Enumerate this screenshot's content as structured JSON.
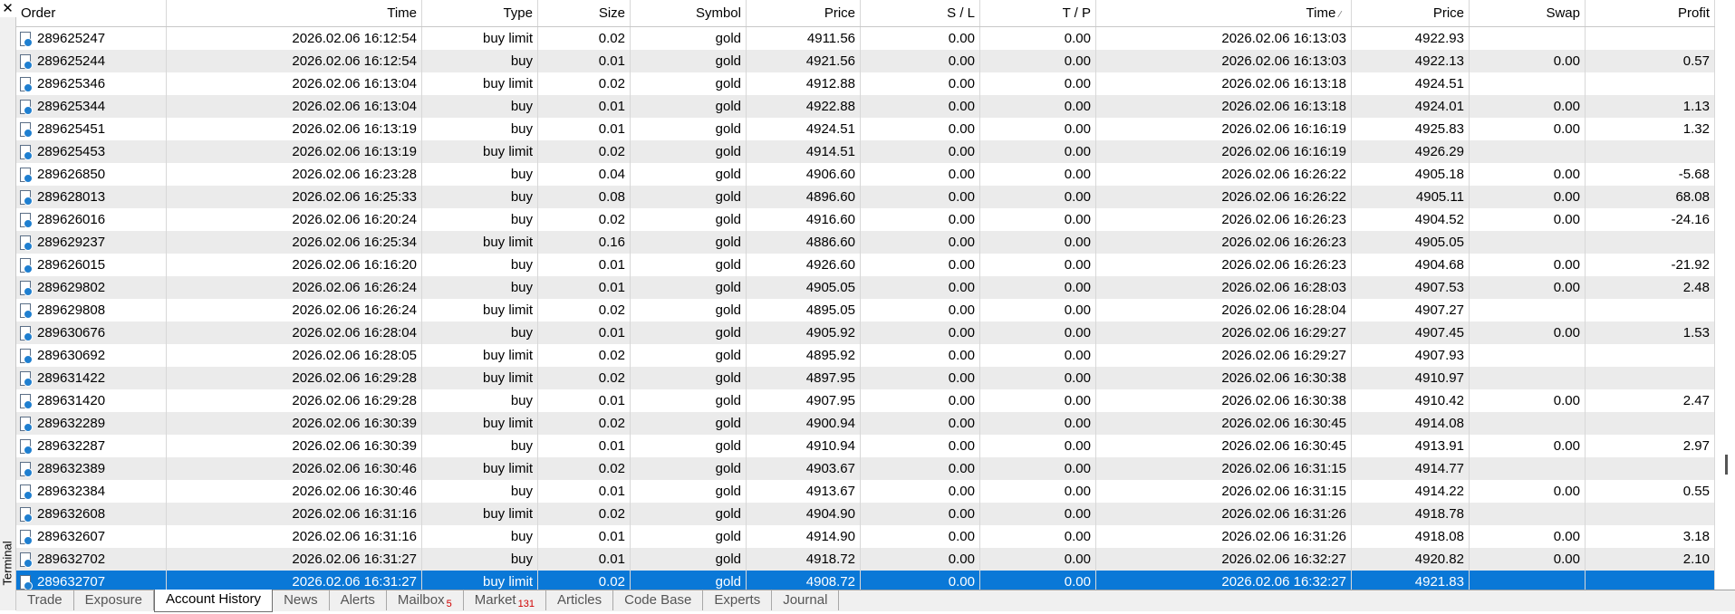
{
  "window": {
    "close_glyph": "✕",
    "side_label": "Terminal"
  },
  "columns": [
    "Order",
    "Time",
    "Type",
    "Size",
    "Symbol",
    "Price",
    "S / L",
    "T / P",
    "Time",
    "Price",
    "Swap",
    "Profit"
  ],
  "sort_indicator": "⁄",
  "rows": [
    [
      "289625247",
      "2026.02.06 16:12:54",
      "buy limit",
      "0.02",
      "gold",
      "4911.56",
      "0.00",
      "0.00",
      "2026.02.06 16:13:03",
      "4922.93",
      "",
      ""
    ],
    [
      "289625244",
      "2026.02.06 16:12:54",
      "buy",
      "0.01",
      "gold",
      "4921.56",
      "0.00",
      "0.00",
      "2026.02.06 16:13:03",
      "4922.13",
      "0.00",
      "0.57"
    ],
    [
      "289625346",
      "2026.02.06 16:13:04",
      "buy limit",
      "0.02",
      "gold",
      "4912.88",
      "0.00",
      "0.00",
      "2026.02.06 16:13:18",
      "4924.51",
      "",
      ""
    ],
    [
      "289625344",
      "2026.02.06 16:13:04",
      "buy",
      "0.01",
      "gold",
      "4922.88",
      "0.00",
      "0.00",
      "2026.02.06 16:13:18",
      "4924.01",
      "0.00",
      "1.13"
    ],
    [
      "289625451",
      "2026.02.06 16:13:19",
      "buy",
      "0.01",
      "gold",
      "4924.51",
      "0.00",
      "0.00",
      "2026.02.06 16:16:19",
      "4925.83",
      "0.00",
      "1.32"
    ],
    [
      "289625453",
      "2026.02.06 16:13:19",
      "buy limit",
      "0.02",
      "gold",
      "4914.51",
      "0.00",
      "0.00",
      "2026.02.06 16:16:19",
      "4926.29",
      "",
      ""
    ],
    [
      "289626850",
      "2026.02.06 16:23:28",
      "buy",
      "0.04",
      "gold",
      "4906.60",
      "0.00",
      "0.00",
      "2026.02.06 16:26:22",
      "4905.18",
      "0.00",
      "-5.68"
    ],
    [
      "289628013",
      "2026.02.06 16:25:33",
      "buy",
      "0.08",
      "gold",
      "4896.60",
      "0.00",
      "0.00",
      "2026.02.06 16:26:22",
      "4905.11",
      "0.00",
      "68.08"
    ],
    [
      "289626016",
      "2026.02.06 16:20:24",
      "buy",
      "0.02",
      "gold",
      "4916.60",
      "0.00",
      "0.00",
      "2026.02.06 16:26:23",
      "4904.52",
      "0.00",
      "-24.16"
    ],
    [
      "289629237",
      "2026.02.06 16:25:34",
      "buy limit",
      "0.16",
      "gold",
      "4886.60",
      "0.00",
      "0.00",
      "2026.02.06 16:26:23",
      "4905.05",
      "",
      ""
    ],
    [
      "289626015",
      "2026.02.06 16:16:20",
      "buy",
      "0.01",
      "gold",
      "4926.60",
      "0.00",
      "0.00",
      "2026.02.06 16:26:23",
      "4904.68",
      "0.00",
      "-21.92"
    ],
    [
      "289629802",
      "2026.02.06 16:26:24",
      "buy",
      "0.01",
      "gold",
      "4905.05",
      "0.00",
      "0.00",
      "2026.02.06 16:28:03",
      "4907.53",
      "0.00",
      "2.48"
    ],
    [
      "289629808",
      "2026.02.06 16:26:24",
      "buy limit",
      "0.02",
      "gold",
      "4895.05",
      "0.00",
      "0.00",
      "2026.02.06 16:28:04",
      "4907.27",
      "",
      ""
    ],
    [
      "289630676",
      "2026.02.06 16:28:04",
      "buy",
      "0.01",
      "gold",
      "4905.92",
      "0.00",
      "0.00",
      "2026.02.06 16:29:27",
      "4907.45",
      "0.00",
      "1.53"
    ],
    [
      "289630692",
      "2026.02.06 16:28:05",
      "buy limit",
      "0.02",
      "gold",
      "4895.92",
      "0.00",
      "0.00",
      "2026.02.06 16:29:27",
      "4907.93",
      "",
      ""
    ],
    [
      "289631422",
      "2026.02.06 16:29:28",
      "buy limit",
      "0.02",
      "gold",
      "4897.95",
      "0.00",
      "0.00",
      "2026.02.06 16:30:38",
      "4910.97",
      "",
      ""
    ],
    [
      "289631420",
      "2026.02.06 16:29:28",
      "buy",
      "0.01",
      "gold",
      "4907.95",
      "0.00",
      "0.00",
      "2026.02.06 16:30:38",
      "4910.42",
      "0.00",
      "2.47"
    ],
    [
      "289632289",
      "2026.02.06 16:30:39",
      "buy limit",
      "0.02",
      "gold",
      "4900.94",
      "0.00",
      "0.00",
      "2026.02.06 16:30:45",
      "4914.08",
      "",
      ""
    ],
    [
      "289632287",
      "2026.02.06 16:30:39",
      "buy",
      "0.01",
      "gold",
      "4910.94",
      "0.00",
      "0.00",
      "2026.02.06 16:30:45",
      "4913.91",
      "0.00",
      "2.97"
    ],
    [
      "289632389",
      "2026.02.06 16:30:46",
      "buy limit",
      "0.02",
      "gold",
      "4903.67",
      "0.00",
      "0.00",
      "2026.02.06 16:31:15",
      "4914.77",
      "",
      ""
    ],
    [
      "289632384",
      "2026.02.06 16:30:46",
      "buy",
      "0.01",
      "gold",
      "4913.67",
      "0.00",
      "0.00",
      "2026.02.06 16:31:15",
      "4914.22",
      "0.00",
      "0.55"
    ],
    [
      "289632608",
      "2026.02.06 16:31:16",
      "buy limit",
      "0.02",
      "gold",
      "4904.90",
      "0.00",
      "0.00",
      "2026.02.06 16:31:26",
      "4918.78",
      "",
      ""
    ],
    [
      "289632607",
      "2026.02.06 16:31:16",
      "buy",
      "0.01",
      "gold",
      "4914.90",
      "0.00",
      "0.00",
      "2026.02.06 16:31:26",
      "4918.08",
      "0.00",
      "3.18"
    ],
    [
      "289632702",
      "2026.02.06 16:31:27",
      "buy",
      "0.01",
      "gold",
      "4918.72",
      "0.00",
      "0.00",
      "2026.02.06 16:32:27",
      "4920.82",
      "0.00",
      "2.10"
    ],
    [
      "289632707",
      "2026.02.06 16:31:27",
      "buy limit",
      "0.02",
      "gold",
      "4908.72",
      "0.00",
      "0.00",
      "2026.02.06 16:32:27",
      "4921.83",
      "",
      ""
    ]
  ],
  "selected_row": 24,
  "tabs": [
    {
      "label": "Trade",
      "badge": ""
    },
    {
      "label": "Exposure",
      "badge": ""
    },
    {
      "label": "Account History",
      "badge": "",
      "active": true
    },
    {
      "label": "News",
      "badge": ""
    },
    {
      "label": "Alerts",
      "badge": ""
    },
    {
      "label": "Mailbox",
      "badge": "5"
    },
    {
      "label": "Market",
      "badge": "131"
    },
    {
      "label": "Articles",
      "badge": ""
    },
    {
      "label": "Code Base",
      "badge": ""
    },
    {
      "label": "Experts",
      "badge": ""
    },
    {
      "label": "Journal",
      "badge": ""
    }
  ],
  "colors": {
    "selected_bg": "#0a78d7",
    "stripe": "#ebebeb",
    "badge": "#d00000"
  }
}
